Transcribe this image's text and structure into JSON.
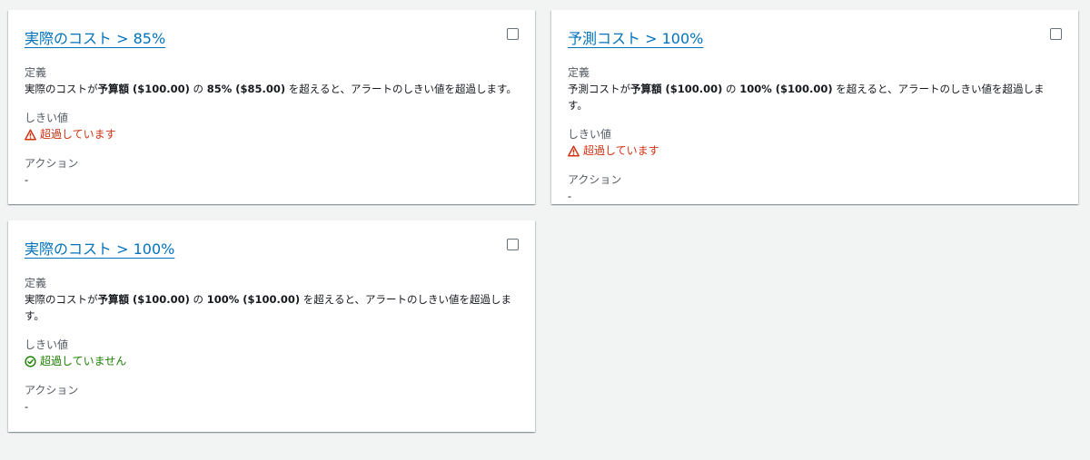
{
  "cards": [
    {
      "title": "実際のコスト > 85%",
      "definition_label": "定義",
      "definition_pre": "実際のコストが",
      "definition_bold1": "予算額 ($100.00)",
      "definition_mid": " の ",
      "definition_bold2": "85% ($85.00)",
      "definition_post": " を超えると、アラートのしきい値を超過します。",
      "threshold_label": "しきい値",
      "threshold_status": "超過しています",
      "threshold_state": "exceeded",
      "action_label": "アクション",
      "action_value": "-"
    },
    {
      "title": "予測コスト > 100%",
      "definition_label": "定義",
      "definition_pre": "予測コストが",
      "definition_bold1": "予算額 ($100.00)",
      "definition_mid": " の ",
      "definition_bold2": "100% ($100.00)",
      "definition_post": " を超えると、アラートのしきい値を超過します。",
      "threshold_label": "しきい値",
      "threshold_status": "超過しています",
      "threshold_state": "exceeded",
      "action_label": "アクション",
      "action_value": "-"
    },
    {
      "title": "実際のコスト > 100%",
      "definition_label": "定義",
      "definition_pre": "実際のコストが",
      "definition_bold1": "予算額 ($100.00)",
      "definition_mid": " の ",
      "definition_bold2": "100% ($100.00)",
      "definition_post": " を超えると、アラートのしきい値を超過します。",
      "threshold_label": "しきい値",
      "threshold_status": "超過していません",
      "threshold_state": "ok",
      "action_label": "アクション",
      "action_value": "-"
    }
  ],
  "icons": {
    "exceeded": "warning-icon",
    "ok": "check-circle-icon"
  },
  "colors": {
    "link": "#0073bb",
    "error": "#d13212",
    "success": "#1d8102",
    "background": "#f2f3f3"
  }
}
